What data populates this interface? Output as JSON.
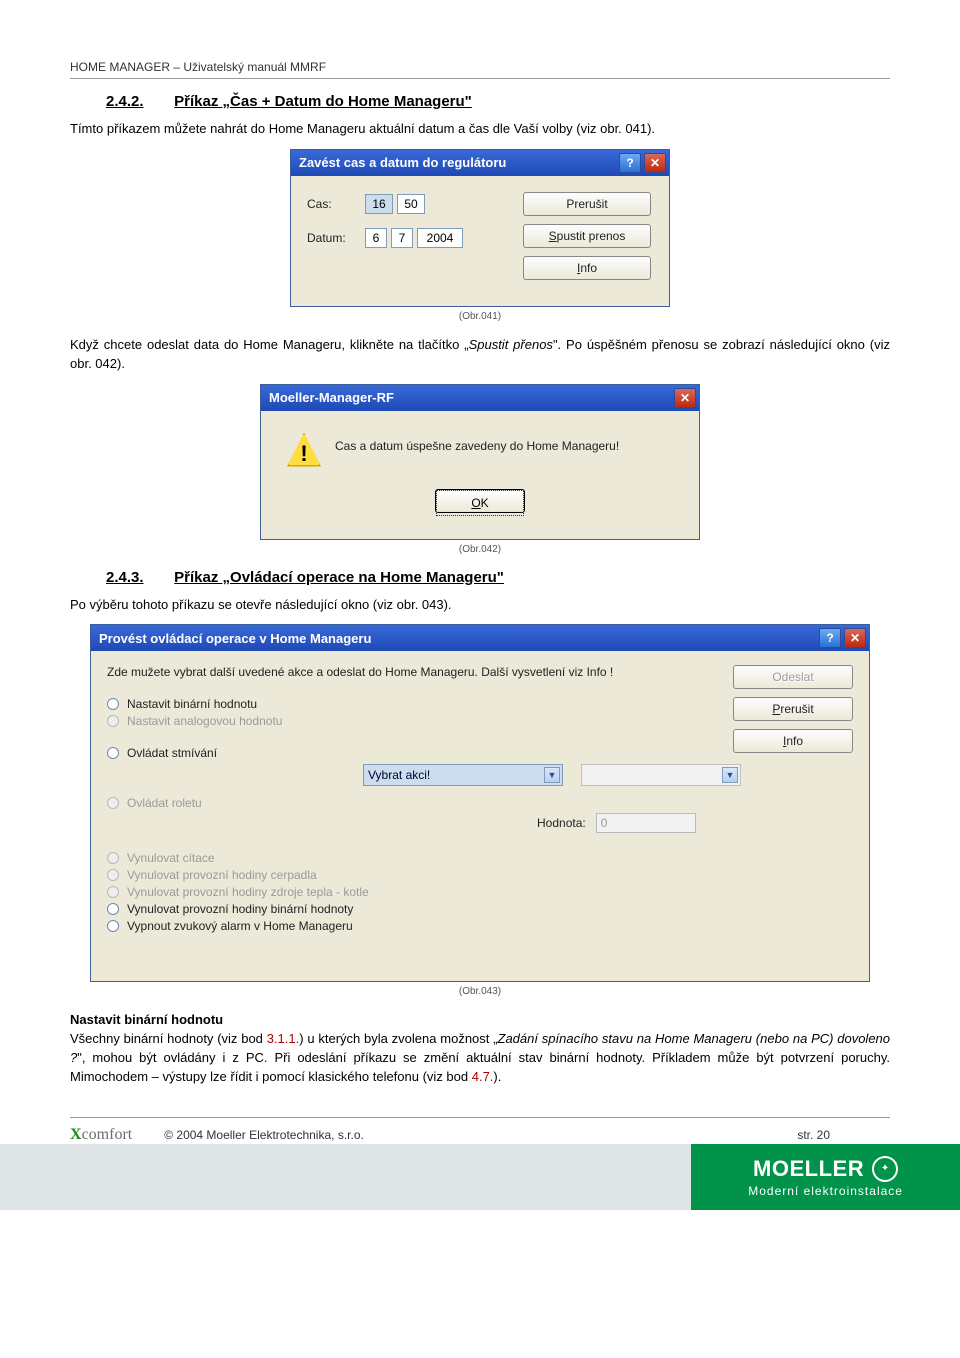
{
  "header": "HOME MANAGER – Uživatelský manuál  MMRF",
  "s242": {
    "num": "2.4.2.",
    "title": "Příkaz „Čas + Datum do Home Manageru\"",
    "para": "Tímto příkazem můžete nahrát do Home Manageru aktuální datum a  čas dle Vaší volby (viz obr. 041)."
  },
  "dlg1": {
    "title": "Zavést cas a datum do regulátoru",
    "lbl_cas": "Cas:",
    "lbl_datum": "Datum:",
    "val_h": "16",
    "val_m": "50",
    "val_d": "6",
    "val_mo": "7",
    "val_y": "2004",
    "btn_prerusit": "Prerušit",
    "btn_spustit_u": "S",
    "btn_spustit_rest": "pustit prenos",
    "btn_info_u": "I",
    "btn_info_rest": "nfo"
  },
  "cap041": "(Obr.041)",
  "para_after041_a": "Když chcete odeslat data do Home Manageru, klikněte na tlačítko „",
  "para_after041_ital": "Spustit přenos",
  "para_after041_b": "\". Po úspěšném přenosu se zobrazí následující okno (viz obr. 042).",
  "dlg2": {
    "title": "Moeller-Manager-RF",
    "msg": "Cas a datum úspešne zavedeny do Home Manageru!",
    "ok_u": "O",
    "ok_rest": "K"
  },
  "cap042": "(Obr.042)",
  "s243": {
    "num": "2.4.3.",
    "title": "Příkaz „Ovládací operace na Home Manageru\"",
    "para": "Po výběru tohoto příkazu se otevře následující okno (viz obr. 043)."
  },
  "dlg3": {
    "title": "Provést ovládací operace v Home Manageru",
    "intro": "Zde mužete vybrat další uvedené akce a odeslat do Home Manageru. Další vysvetlení viz Info !",
    "btn_odeslat": "Odeslat",
    "btn_prerusit_u": "P",
    "btn_prerusit_rest": "rerušit",
    "btn_info_u": "I",
    "btn_info_rest": "nfo",
    "r1": "Nastavit binární hodnotu",
    "r2": "Nastavit analogovou hodnotu",
    "r3": "Ovládat stmívání",
    "r4": "Ovládat roletu",
    "sel1": "Vybrat akci!",
    "hod_lbl": "Hodnota:",
    "hod_val": "0",
    "r5": "Vynulovat cítace",
    "r6": "Vynulovat provozní hodiny cerpadla",
    "r7": "Vynulovat provozní hodiny zdroje tepla - kotle",
    "r8": "Vynulovat provozní hodiny binární hodnoty",
    "r9": "Vypnout zvukový alarm v Home Manageru"
  },
  "cap043": "(Obr.043)",
  "bot": {
    "h": "Nastavit binární hodnotu",
    "a": "Všechny binární hodnoty (viz bod ",
    "red1": "3.1.1.",
    "b": ") u kterých byla zvolena možnost „",
    "ital": "Zadání spínacího stavu na Home Manageru (nebo na PC) dovoleno ?",
    "c": "\", mohou být ovládány i z PC. Při odeslání příkazu se změní  aktuální stav binární hodnoty. Příkladem může být potvrzení poruchy. Mimochodem – výstupy lze řídit i pomocí klasického telefonu (viz bod ",
    "red2": "4.7.",
    "d": ")."
  },
  "footer": {
    "x": "X",
    "comfort": "comfort",
    "copy": "© 2004 Moeller Elektrotechnika, s.r.o.",
    "page": "str. 20"
  },
  "moeller": {
    "name": "MOELLER",
    "sub": "Moderní elektroinstalace"
  }
}
